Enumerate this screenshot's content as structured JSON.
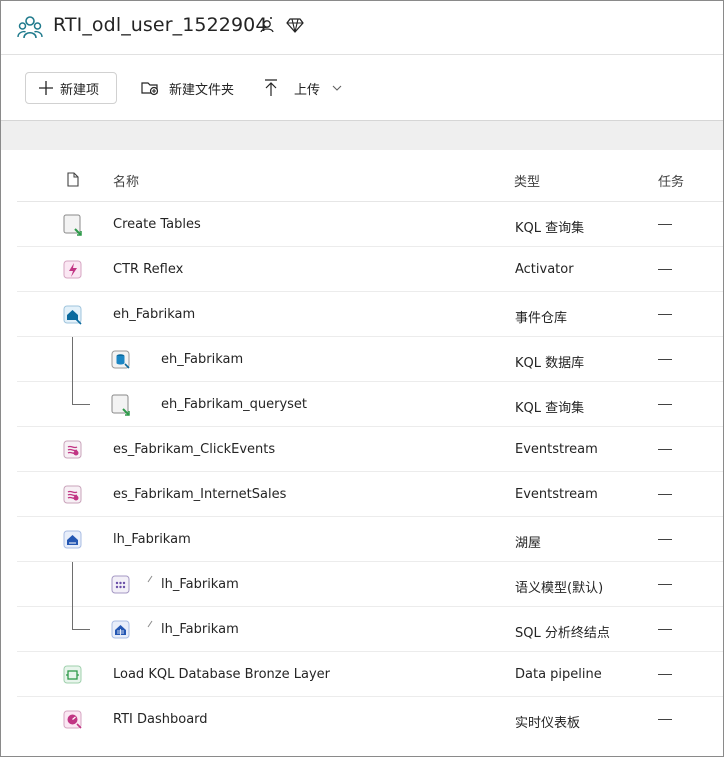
{
  "workspace": {
    "title": "RTI_odl_user_1522904",
    "icon": "workspace-people-icon"
  },
  "toolbar": {
    "new_item": "新建项",
    "new_folder": "新建文件夹",
    "upload": "上传"
  },
  "table": {
    "headers": {
      "name": "名称",
      "type": "类型",
      "task": "任务"
    },
    "rows": [
      {
        "name": "Create Tables",
        "type": "KQL 查询集",
        "task": "—",
        "icon": "kql-queryset-icon",
        "indent": 0
      },
      {
        "name": "CTR Reflex",
        "type": "Activator",
        "task": "—",
        "icon": "activator-icon",
        "indent": 0
      },
      {
        "name": "eh_Fabrikam",
        "type": "事件仓库",
        "task": "—",
        "icon": "eventhouse-icon",
        "indent": 0
      },
      {
        "name": "eh_Fabrikam",
        "type": "KQL 数据库",
        "task": "—",
        "icon": "kql-database-icon",
        "indent": 1
      },
      {
        "name": "eh_Fabrikam_queryset",
        "type": "KQL 查询集",
        "task": "—",
        "icon": "kql-queryset-icon",
        "indent": 1
      },
      {
        "name": "es_Fabrikam_ClickEvents",
        "type": "Eventstream",
        "task": "—",
        "icon": "eventstream-icon",
        "indent": 0
      },
      {
        "name": "es_Fabrikam_InternetSales",
        "type": "Eventstream",
        "task": "—",
        "icon": "eventstream-icon",
        "indent": 0
      },
      {
        "name": "lh_Fabrikam",
        "type": "湖屋",
        "task": "—",
        "icon": "lakehouse-icon",
        "indent": 0
      },
      {
        "name": "lh_Fabrikam",
        "type": "语义模型(默认)",
        "task": "—",
        "icon": "semantic-model-icon",
        "indent": 1
      },
      {
        "name": "lh_Fabrikam",
        "type": "SQL 分析终结点",
        "task": "—",
        "icon": "sql-endpoint-icon",
        "indent": 1
      },
      {
        "name": "Load KQL Database Bronze Layer",
        "type": "Data pipeline",
        "task": "—",
        "icon": "data-pipeline-icon",
        "indent": 0
      },
      {
        "name": "RTI Dashboard",
        "type": "实时仪表板",
        "task": "—",
        "icon": "realtime-dashboard-icon",
        "indent": 0
      }
    ]
  },
  "colors": {
    "workspace_icon": "#1f7a8c",
    "kql_green": "#2e9a4a",
    "activator_pink": "#c13584",
    "eventhouse_blue": "#0b6a9e",
    "lakehouse_blue": "#2457b3",
    "semantic_purple": "#6b4fa8"
  }
}
